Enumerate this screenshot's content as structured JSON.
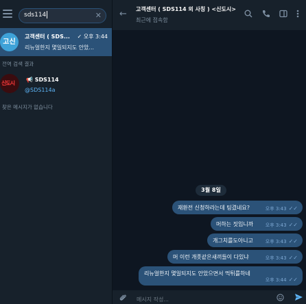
{
  "search": {
    "value": "sds114"
  },
  "chat_result": {
    "avatar_text": "고신",
    "title": "고객센터 ( SDS...",
    "time": "오후 3:44",
    "check": "✓",
    "preview": "리뉴얼한지 몇일되지도 안았..."
  },
  "sections": {
    "global": "전역 검색 결과",
    "none": "찾은 메시지가 없습니다"
  },
  "global_result": {
    "avatar_text": "신도시",
    "name": "📢 SDS114",
    "username": "@SDS114a"
  },
  "header": {
    "title": "고객센터 ( SDS114 외 사칭 ) <신도시>",
    "status": "최근에 접속함"
  },
  "date_divider": "3월 8일",
  "messages": [
    {
      "text": "재환전 신청하라는데 팅겼네요?",
      "time": "오후 3:43",
      "check": "✓✓"
    },
    {
      "text": "머하는 짓입니까",
      "time": "오후 3:43",
      "check": "✓✓"
    },
    {
      "text": "개그치를도아니고",
      "time": "오후 3:43",
      "check": "✓✓"
    },
    {
      "text": "머 이런 개좃같은새끼들이 다있냐",
      "time": "오후 3:43",
      "check": "✓✓"
    },
    {
      "text": "리뉴얼한지 몇일되지도 안았으면서 먹튀를하네",
      "time": "오후 3:44",
      "check": "✓✓"
    }
  ],
  "composer": {
    "placeholder": "메시지 작성..."
  },
  "icons": {
    "menu": "menu-icon",
    "clear": "close-icon",
    "back": "arrow-left-icon",
    "search": "search-icon",
    "call": "phone-icon",
    "sidebar": "sidebar-toggle-icon",
    "more": "more-vertical-icon",
    "attach": "paperclip-icon",
    "emoji": "emoji-icon",
    "send": "send-icon"
  },
  "colors": {
    "accent": "#2b5278",
    "link": "#5eb5f7",
    "background": "#0e1621",
    "panel": "#17212b"
  }
}
